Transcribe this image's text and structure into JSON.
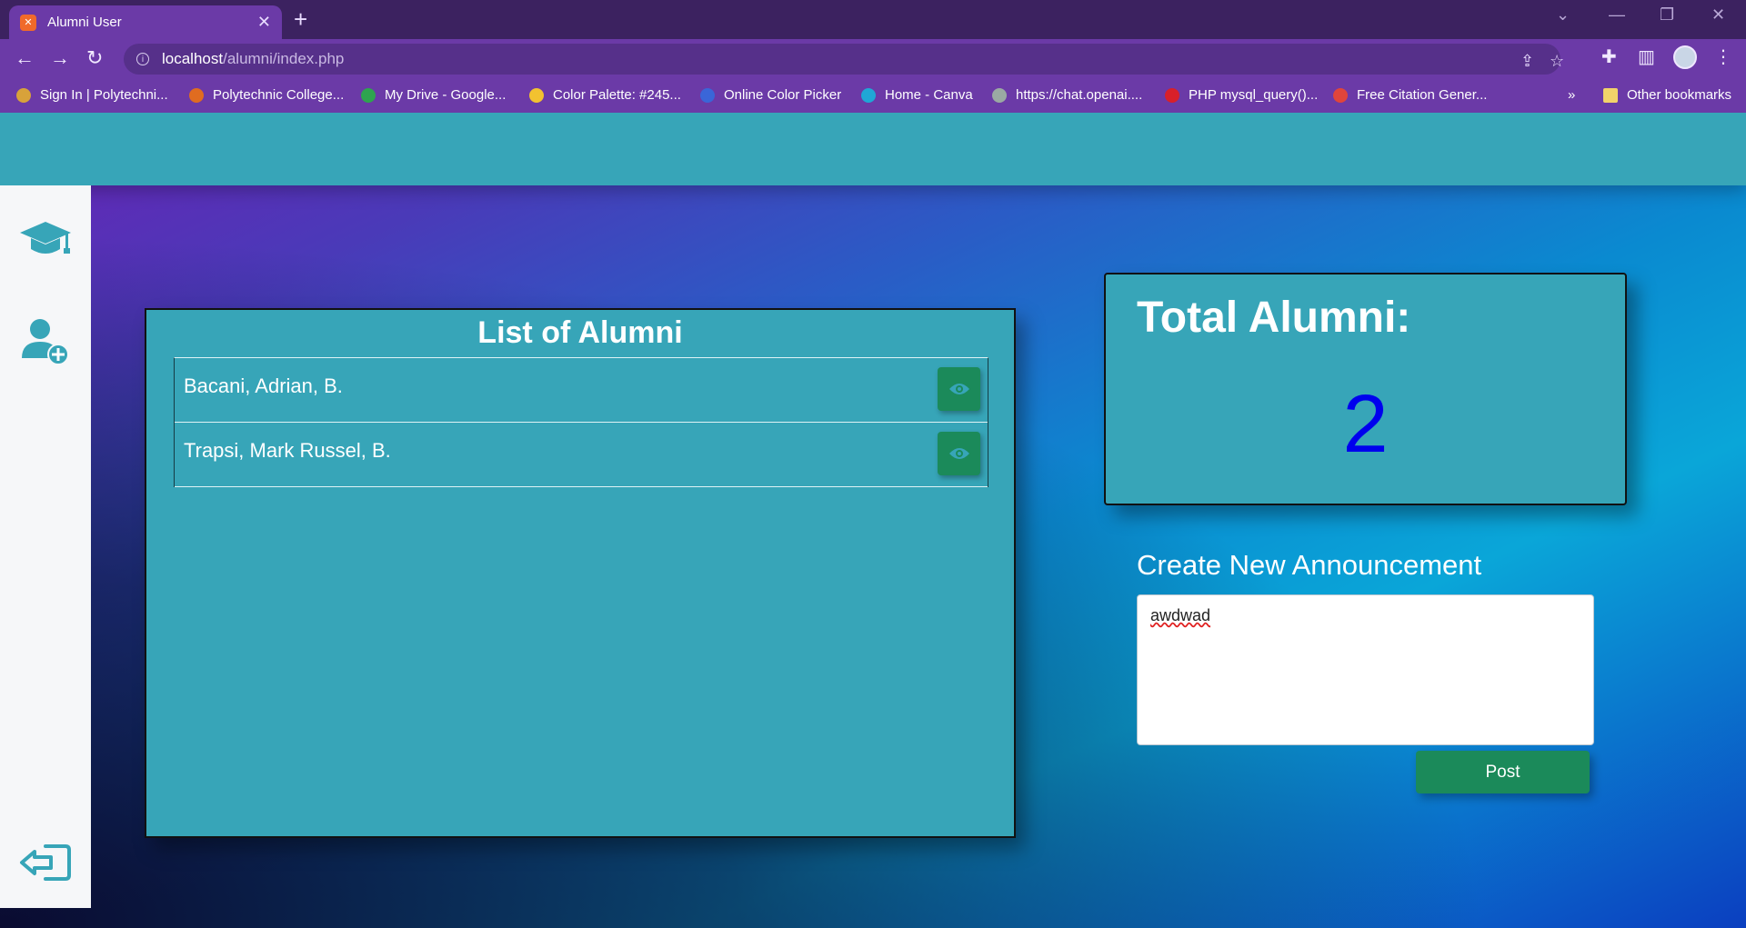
{
  "browser": {
    "tab_title": "Alumni User",
    "url_host": "localhost",
    "url_path": "/alumni/index.php",
    "bookmarks": [
      {
        "label": "Sign In | Polytechni...",
        "icon": "seal-icon",
        "color": "#d8a23a"
      },
      {
        "label": "Polytechnic College...",
        "icon": "college-icon",
        "color": "#e06c20"
      },
      {
        "label": "My Drive - Google...",
        "icon": "google-drive-icon",
        "color": "#2ea44f"
      },
      {
        "label": "Color Palette: #245...",
        "icon": "palette-icon",
        "color": "#f2c230"
      },
      {
        "label": "Online Color Picker",
        "icon": "eyedropper-icon",
        "color": "#3a66d8"
      },
      {
        "label": "Home - Canva",
        "icon": "canva-icon",
        "color": "#1fa7d6"
      },
      {
        "label": "https://chat.openai....",
        "icon": "openai-icon",
        "color": "#9aa9a3"
      },
      {
        "label": "PHP mysql_query()...",
        "icon": "php-icon",
        "color": "#d8202a"
      },
      {
        "label": "Free Citation Gener...",
        "icon": "citation-icon",
        "color": "#e0453a"
      }
    ],
    "other_bookmarks": "Other bookmarks",
    "overflow": "»"
  },
  "sidebar": {
    "items": [
      {
        "icon": "graduation-cap-icon"
      },
      {
        "icon": "add-user-icon"
      },
      {
        "icon": "logout-icon"
      }
    ]
  },
  "alumni_list": {
    "title": "List of Alumni",
    "rows": [
      {
        "name": "Bacani, Adrian, B."
      },
      {
        "name": "Trapsi, Mark Russel, B."
      }
    ]
  },
  "total": {
    "label": "Total Alumni:",
    "value": "2"
  },
  "announcement": {
    "title": "Create New Announcement",
    "text": "awdwad",
    "post_label": "Post"
  },
  "colors": {
    "panel": "#37a5b8",
    "button": "#1b8a5a",
    "total_value": "#0000ee",
    "browser_frame": "#6b3aa7"
  }
}
